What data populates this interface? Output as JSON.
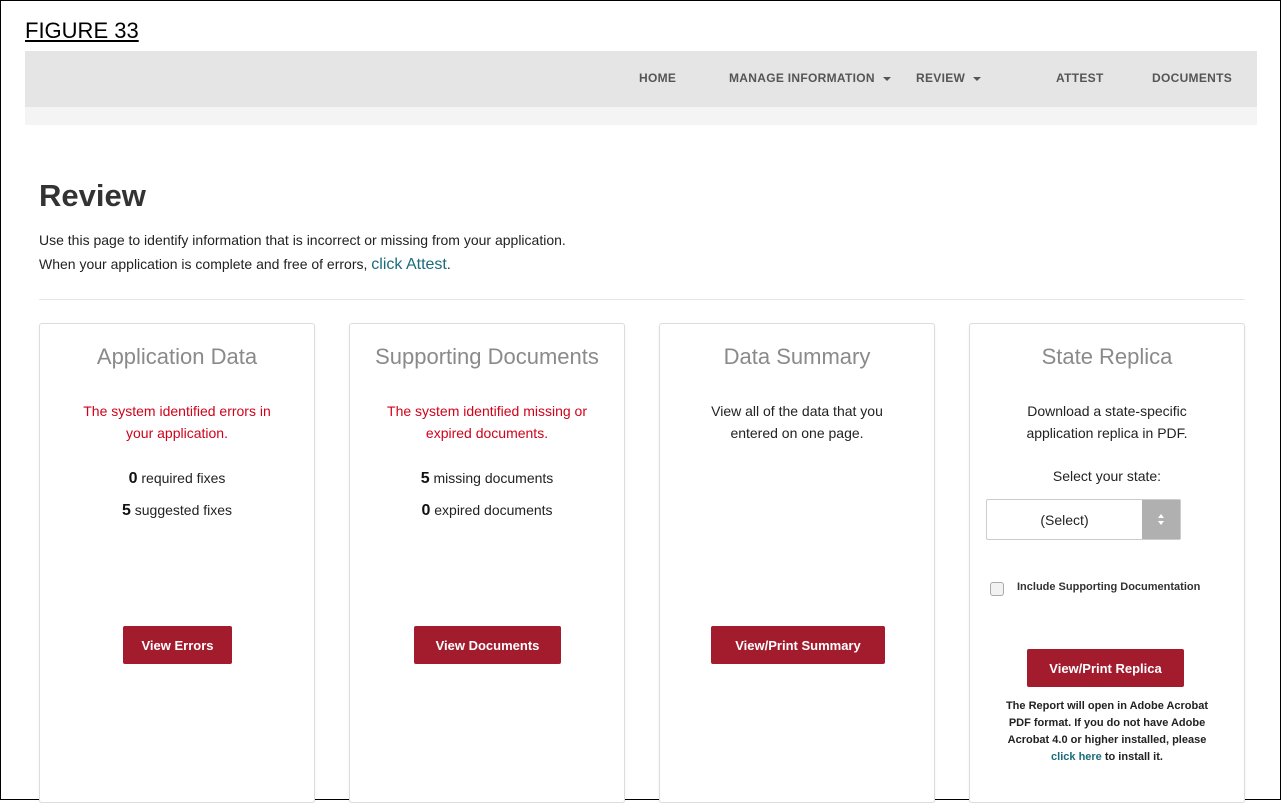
{
  "figure_label": "FIGURE 33",
  "nav": {
    "items": [
      "HOME",
      "MANAGE INFORMATION",
      "REVIEW",
      "ATTEST",
      "DOCUMENTS"
    ]
  },
  "page": {
    "title": "Review",
    "intro_line1": "Use this page to identify information that is incorrect or missing from your application.",
    "intro_line2_prefix": "When your application is complete and free of errors, ",
    "intro_line2_link": "click Attest",
    "intro_line2_suffix": "."
  },
  "cards": {
    "application_data": {
      "title": "Application Data",
      "message_line1": "The system identified errors in",
      "message_line2": "your application.",
      "required_count": "0",
      "required_label": " required fixes",
      "suggested_count": "5",
      "suggested_label": " suggested fixes",
      "button": "View Errors"
    },
    "supporting_documents": {
      "title": "Supporting Documents",
      "message_line1": "The system identified missing or",
      "message_line2": "expired documents.",
      "missing_count": "5",
      "missing_label": " missing documents",
      "expired_count": "0",
      "expired_label": " expired documents",
      "button": "View Documents"
    },
    "data_summary": {
      "title": "Data Summary",
      "message_line1": "View all of the data that you",
      "message_line2": "entered on one page.",
      "button": "View/Print Summary"
    },
    "state_replica": {
      "title": "State Replica",
      "message_line1": "Download a state-specific",
      "message_line2": "application replica in PDF.",
      "select_label": "Select your state:",
      "select_value": "(Select)",
      "checkbox_label": "Include Supporting Documentation",
      "checkbox_checked": false,
      "button": "View/Print Replica",
      "note_line1": "The Report will open in Adobe Acrobat",
      "note_line2": "PDF format. If you do not have Adobe",
      "note_line3": "Acrobat 4.0 or higher installed, please",
      "note_link": "click here",
      "note_suffix": " to install it."
    }
  },
  "colors": {
    "accent_button": "#a31c2e",
    "error_text": "#d0021b",
    "link": "#1b6b7b",
    "navbar_bg": "#e5e5e5"
  }
}
